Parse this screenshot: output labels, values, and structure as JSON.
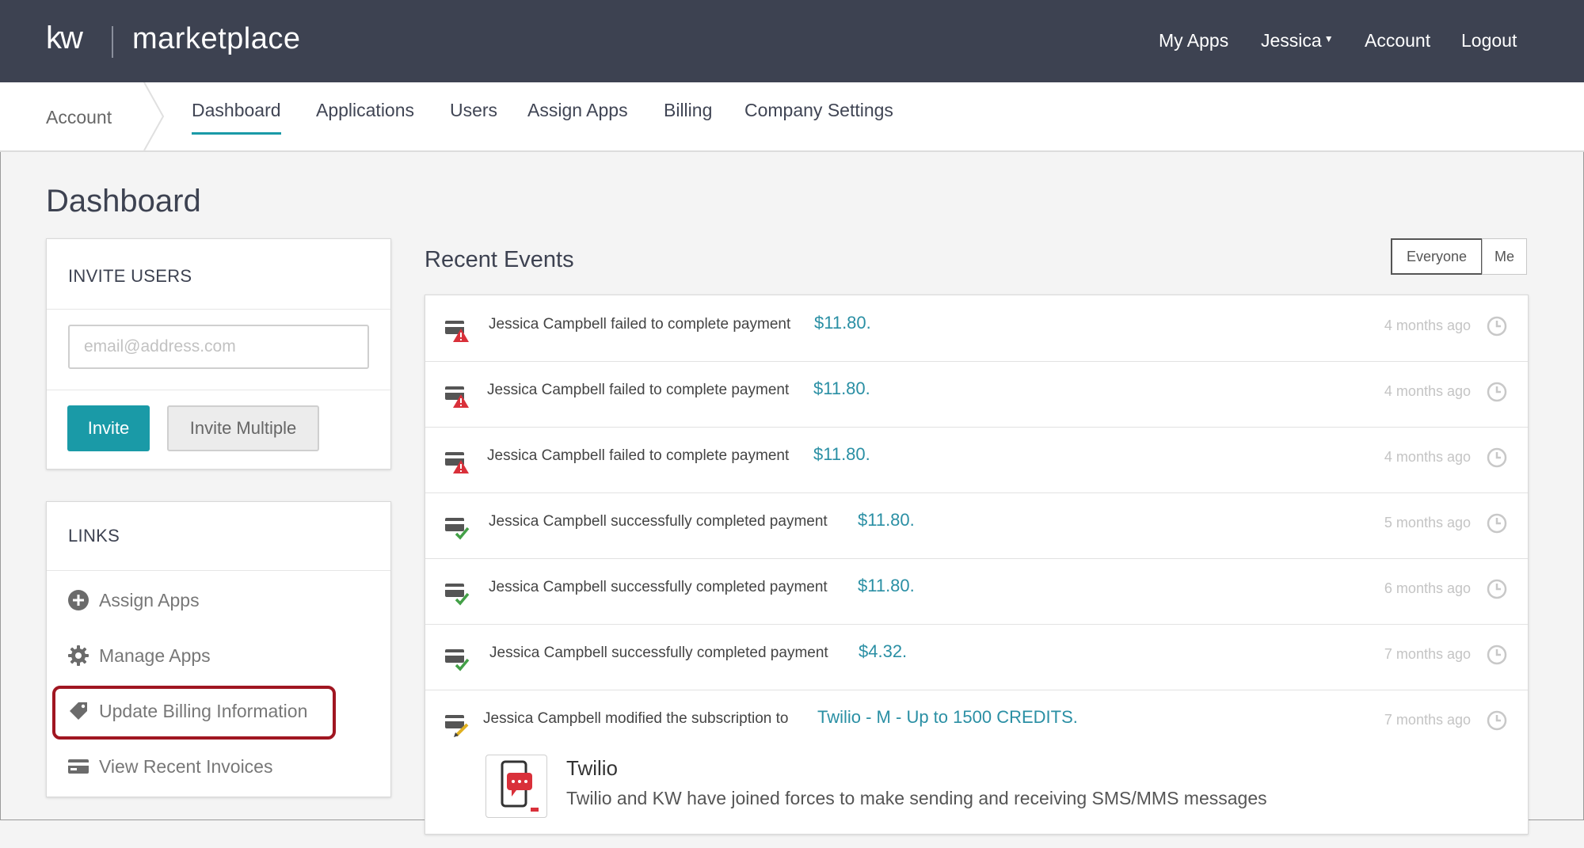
{
  "header": {
    "logo_kw": "kw",
    "logo_text": "marketplace",
    "nav": {
      "my_apps": "My Apps",
      "user": "Jessica",
      "account": "Account",
      "logout": "Logout"
    }
  },
  "subnav": {
    "breadcrumb": "Account",
    "tabs": [
      "Dashboard",
      "Applications",
      "Users",
      "Assign Apps",
      "Billing",
      "Company Settings"
    ]
  },
  "page_title": "Dashboard",
  "invite": {
    "title": "INVITE USERS",
    "email_placeholder": "email@address.com",
    "invite_label": "Invite",
    "invite_multiple_label": "Invite Multiple"
  },
  "links": {
    "title": "LINKS",
    "items": [
      {
        "label": "Assign Apps",
        "icon": "plus-circle-icon"
      },
      {
        "label": "Manage Apps",
        "icon": "gear-icon"
      },
      {
        "label": "Update Billing Information",
        "icon": "tag-icon"
      },
      {
        "label": "View Recent Invoices",
        "icon": "credit-card-icon"
      }
    ]
  },
  "recent_events": {
    "title": "Recent Events",
    "filter": {
      "everyone": "Everyone",
      "me": "Me"
    },
    "items": [
      {
        "text": "Jessica Campbell failed to complete payment",
        "amount": "$11.80.",
        "time": "4 months ago",
        "status": "failed"
      },
      {
        "text": "Jessica Campbell failed to complete payment",
        "amount": "$11.80.",
        "time": "4 months ago",
        "status": "failed"
      },
      {
        "text": "Jessica Campbell failed to complete payment",
        "amount": "$11.80.",
        "time": "4 months ago",
        "status": "failed"
      },
      {
        "text": "Jessica Campbell successfully completed payment",
        "amount": "$11.80.",
        "time": "5 months ago",
        "status": "success"
      },
      {
        "text": "Jessica Campbell successfully completed payment",
        "amount": "$11.80.",
        "time": "6 months ago",
        "status": "success"
      },
      {
        "text": "Jessica Campbell successfully completed payment",
        "amount": "$4.32.",
        "time": "7 months ago",
        "status": "success"
      },
      {
        "text": "Jessica Campbell modified the subscription to",
        "amount": "Twilio - M - Up to 1500 CREDITS.",
        "time": "7 months ago",
        "status": "modified"
      }
    ],
    "app_card": {
      "name": "Twilio",
      "description": "Twilio and KW have joined forces to make sending and receiving SMS/MMS messages"
    }
  },
  "colors": {
    "header_bg": "#3d4251",
    "accent": "#1a9aa7",
    "link_amount": "#2a8fa4",
    "error_red": "#d9303a",
    "success_green": "#43a047",
    "highlight_border": "#a01621"
  }
}
